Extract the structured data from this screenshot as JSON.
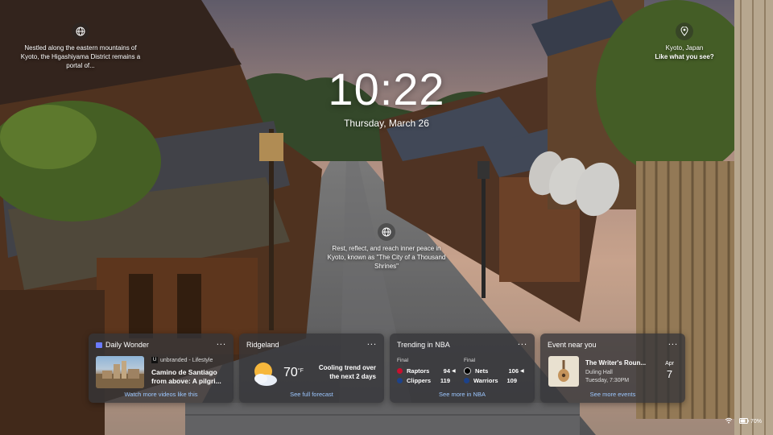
{
  "lockscreen": {
    "time": "10:22",
    "date": "Thursday, March 26"
  },
  "spotlight": {
    "left_text": "Nestled along the eastern mountains of Kyoto, the Higashiyama District remains a portal of...",
    "location": "Kyoto, Japan",
    "location_prompt": "Like what you see?",
    "center_text": "Rest, reflect, and reach inner peace in Kyoto, known as \"The City of a Thousand Shrines\""
  },
  "widgets": {
    "daily_wonder": {
      "title": "Daily Wonder",
      "more": "...",
      "source_logo": "U",
      "source": "unbranded - Lifestyle",
      "headline": "Camino de Santiago from above: A pilgri...",
      "link": "Watch more videos like this",
      "accent": "#6b7bff"
    },
    "weather": {
      "title": "Ridgeland",
      "more": "...",
      "temp": "70",
      "unit": "°F",
      "condition": "Cooling trend over the next 2 days",
      "link": "See full forecast"
    },
    "nba": {
      "title": "Trending in NBA",
      "more": "...",
      "games": [
        {
          "status": "Final",
          "teams": [
            {
              "name": "Raptors",
              "score": "94",
              "winner": true,
              "color": "#c8102e"
            },
            {
              "name": "Clippers",
              "score": "119",
              "winner": false,
              "color": "#1d428a"
            }
          ]
        },
        {
          "status": "Final",
          "teams": [
            {
              "name": "Nets",
              "score": "106",
              "winner": true,
              "color": "#000000"
            },
            {
              "name": "Warriors",
              "score": "109",
              "winner": false,
              "color": "#1d428a"
            }
          ]
        }
      ],
      "link": "See more in NBA"
    },
    "event": {
      "title": "Event near you",
      "more": "...",
      "name": "The Writer's Roun...",
      "venue": "Duling Hall",
      "time": "Tuesday, 7:30PM",
      "month": "Apr",
      "day": "7",
      "link": "See more events"
    }
  },
  "system_tray": {
    "wifi_icon": "wifi-icon",
    "battery_icon": "battery-icon",
    "battery": "70%"
  },
  "colors": {
    "link": "#9cc7ff",
    "widget_bg": "#343438"
  }
}
